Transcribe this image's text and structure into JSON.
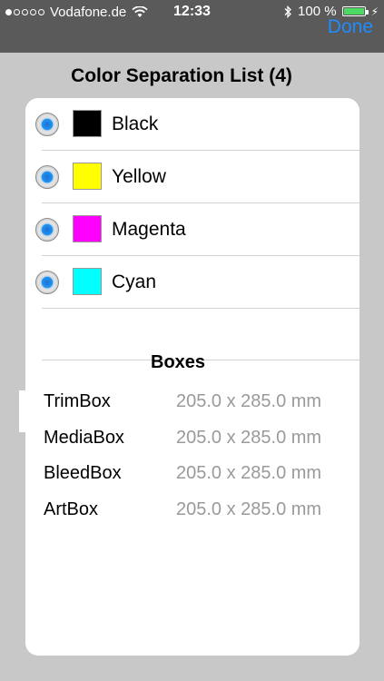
{
  "status_bar": {
    "carrier": "Vodafone.de",
    "time": "12:33",
    "battery_percent": "100 %",
    "done_label": "Done"
  },
  "title": "Color Separation List (4)",
  "separations": [
    {
      "name": "Black",
      "color": "#000000"
    },
    {
      "name": "Yellow",
      "color": "#ffff00"
    },
    {
      "name": "Magenta",
      "color": "#ff00ff"
    },
    {
      "name": "Cyan",
      "color": "#00ffff"
    }
  ],
  "boxes": {
    "title": "Boxes",
    "items": [
      {
        "name": "TrimBox",
        "value": "205.0 x 285.0 mm"
      },
      {
        "name": "MediaBox",
        "value": "205.0 x 285.0 mm"
      },
      {
        "name": "BleedBox",
        "value": "205.0 x 285.0 mm"
      },
      {
        "name": "ArtBox",
        "value": "205.0 x 285.0 mm"
      }
    ]
  }
}
